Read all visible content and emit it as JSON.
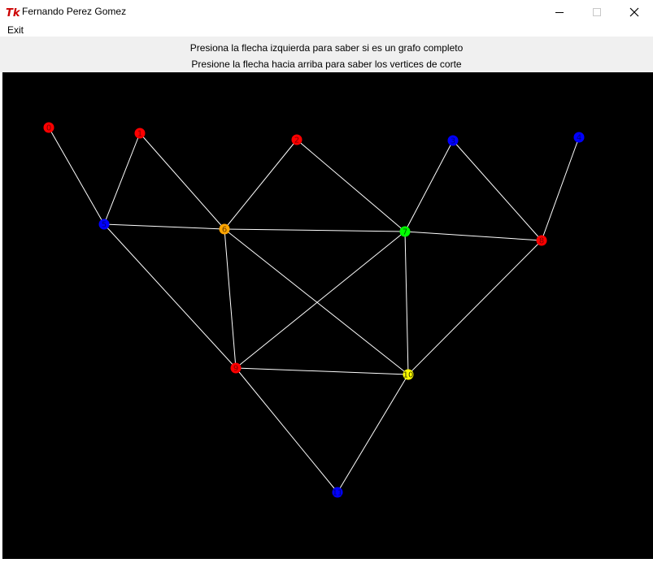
{
  "window": {
    "title": "Fernando Perez Gomez",
    "app_icon": "tk-feather-icon",
    "controls": {
      "minimize_icon": "minimize-icon",
      "maximize_icon": "maximize-icon",
      "close_icon": "close-icon"
    }
  },
  "menu": {
    "exit_label": "Exit"
  },
  "instructions": {
    "line1": "Presiona la flecha izquierda para saber si es un grafo completo",
    "line2": "Presione la flecha hacia arriba para saber los vertices de corte"
  },
  "colors": {
    "canvas_bg": "#000000",
    "edge": "#ffffff",
    "red": "#ff0000",
    "blue": "#0000ff",
    "orange": "#ffa500",
    "green": "#00ff00",
    "yellow": "#ffff00"
  },
  "graph": {
    "nodes": [
      {
        "label": "0",
        "color": "red"
      },
      {
        "label": "1",
        "color": "red"
      },
      {
        "label": "2",
        "color": "red"
      },
      {
        "label": "3",
        "color": "blue"
      },
      {
        "label": "4",
        "color": "blue"
      },
      {
        "label": "5",
        "color": "blue"
      },
      {
        "label": "6",
        "color": "orange"
      },
      {
        "label": "7",
        "color": "green"
      },
      {
        "label": "8",
        "color": "red"
      },
      {
        "label": "9",
        "color": "red"
      },
      {
        "label": "10",
        "color": "yellow"
      },
      {
        "label": "11",
        "color": "blue"
      }
    ],
    "edges": [
      [
        "0",
        "5"
      ],
      [
        "1",
        "5"
      ],
      [
        "1",
        "6"
      ],
      [
        "2",
        "6"
      ],
      [
        "2",
        "7"
      ],
      [
        "3",
        "7"
      ],
      [
        "3",
        "8"
      ],
      [
        "4",
        "8"
      ],
      [
        "5",
        "6"
      ],
      [
        "6",
        "7"
      ],
      [
        "7",
        "8"
      ],
      [
        "5",
        "9"
      ],
      [
        "6",
        "9"
      ],
      [
        "6",
        "10"
      ],
      [
        "7",
        "9"
      ],
      [
        "7",
        "10"
      ],
      [
        "8",
        "10"
      ],
      [
        "9",
        "10"
      ],
      [
        "9",
        "11"
      ],
      [
        "10",
        "11"
      ]
    ]
  }
}
